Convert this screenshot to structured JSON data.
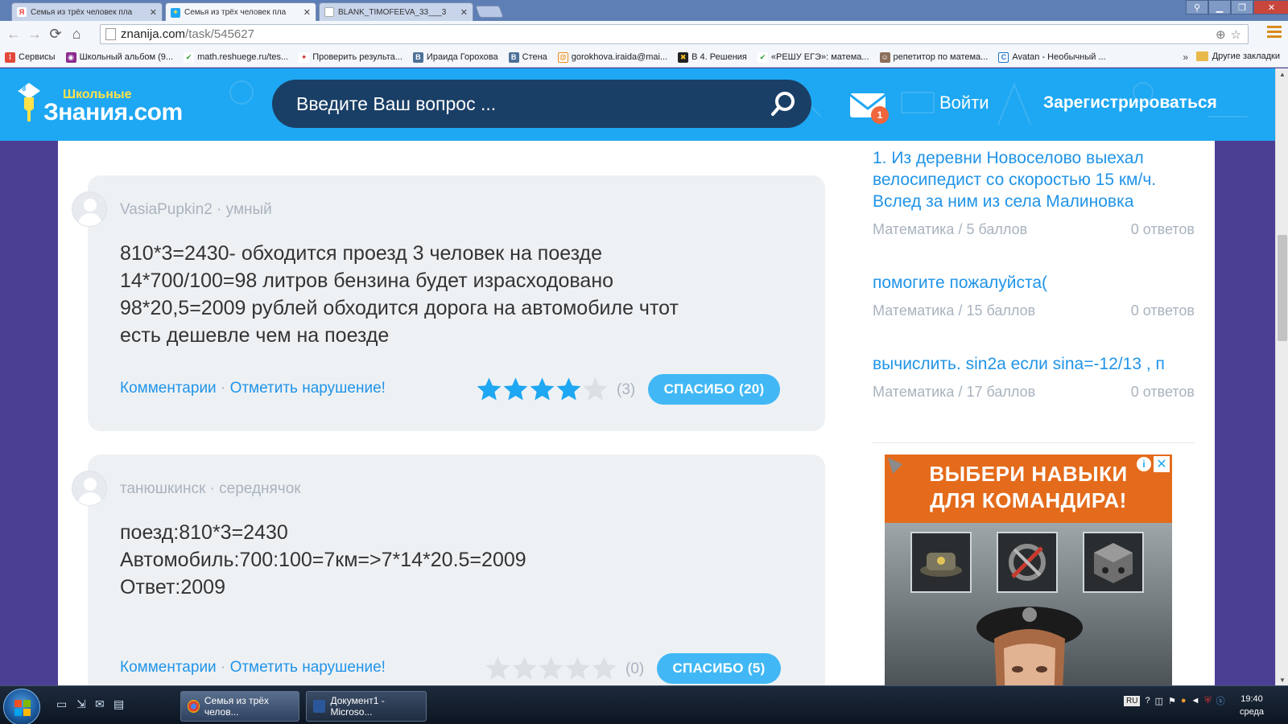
{
  "browser": {
    "tabs": [
      {
        "title": "Семья из трёх человек пла",
        "favicon": "yandex-icon"
      },
      {
        "title": "Семья из трёх человек пла",
        "favicon": "znanija-icon"
      },
      {
        "title": "BLANK_TIMOFEEVA_33___3",
        "favicon": "document-icon"
      }
    ],
    "url_domain": "znanija.com",
    "url_path": "/task/545627",
    "bookmarks": [
      {
        "label": "Сервисы"
      },
      {
        "label": "Школьный альбом (9..."
      },
      {
        "label": "math.reshuege.ru/tes..."
      },
      {
        "label": "Проверить результа..."
      },
      {
        "label": "Ираида Горохова"
      },
      {
        "label": "Стена"
      },
      {
        "label": "gorokhova.iraida@mai..."
      },
      {
        "label": "В 4. Решения"
      },
      {
        "label": "«РЕШУ ЕГЭ»: матема..."
      },
      {
        "label": "репетитор по матема..."
      },
      {
        "label": "Avatan - Необычный ..."
      }
    ],
    "bookmarks_more": "»",
    "other_bookmarks": "Другие закладки"
  },
  "header": {
    "logo_small": "Школьные",
    "logo_big": "Знания.com",
    "search_placeholder": "Введите Ваш вопрос ...",
    "mail_badge": "1",
    "login": "Войти",
    "register": "Зарегистрироваться"
  },
  "answers": [
    {
      "author": "VasiaPupkin2 · умный",
      "text": "810*3=2430- обходится проезд 3 человек на поезде\n14*700/100=98 литров бензина будет израсходовано\n98*20,5=2009 рублей обходится дорога на автомобиле чтот\nесть дешевле чем на поезде",
      "comments_label": "Комментарии",
      "report_label": "Отметить нарушение!",
      "stars_filled": 4,
      "rating_count": "(3)",
      "thanks_label": "СПАСИБО",
      "thanks_count": "(20)"
    },
    {
      "author": "танюшкинск · середнячок",
      "text": "поезд:810*3=2430\nАвтомобиль:700:100=7км=>7*14*20.5=2009\nОтвет:2009",
      "comments_label": "Комментарии",
      "report_label": "Отметить нарушение!",
      "stars_filled": 0,
      "rating_count": "(0)",
      "thanks_label": "СПАСИБО",
      "thanks_count": "(5)"
    }
  ],
  "sidebar": {
    "questions": [
      {
        "title": "1. Из деревни Новоселово выехал велосипедист со скоростью 15 км/ч. Вслед за ним из села Малиновка",
        "subject": "Математика",
        "points": "5 баллов",
        "answers": "0 ответов"
      },
      {
        "title": "помогите пожалуйста(",
        "subject": "Математика",
        "points": "15 баллов",
        "answers": "0 ответов"
      },
      {
        "title": "вычислить. sin2a если sina=-12/13 , п",
        "subject": "Математика",
        "points": "17 баллов",
        "answers": "0 ответов"
      }
    ],
    "meta_separator": "/"
  },
  "ad": {
    "title_line1": "ВЫБЕРИ НАВЫКИ",
    "title_line2": "ДЛЯ КОМАНДИРА!",
    "info": "i",
    "close": "✕"
  },
  "taskbar": {
    "tasks": [
      {
        "label": "Семья из трёх челов..."
      },
      {
        "label": "Документ1 - Microso..."
      }
    ],
    "lang": "RU",
    "time": "19:40",
    "day": "среда"
  },
  "colors": {
    "brand_blue": "#1ea7f2",
    "link_blue": "#2094e8",
    "thanks_blue": "#41b8f5",
    "star_filled": "#1ea7f2",
    "star_empty": "#dcdfe3",
    "ad_orange": "#e46b1b"
  }
}
